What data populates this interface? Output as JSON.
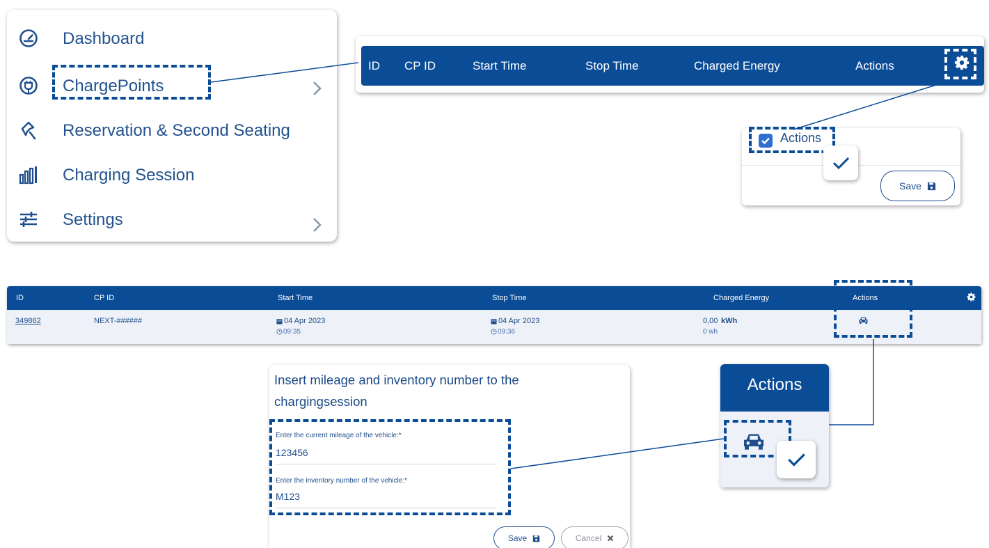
{
  "sidebar": {
    "items": [
      {
        "label": "Dashboard",
        "icon": "speedometer-icon"
      },
      {
        "label": "ChargePoints",
        "icon": "plug-icon"
      },
      {
        "label": "Reservation & Second Seating",
        "icon": "pin-icon"
      },
      {
        "label": "Charging Session",
        "icon": "bar-chart-icon"
      },
      {
        "label": "Settings",
        "icon": "sliders-icon"
      }
    ]
  },
  "header_strip": {
    "columns": [
      "ID",
      "CP ID",
      "Start Time",
      "Stop Time",
      "Charged Energy",
      "Actions"
    ],
    "settings_icon": "gear-icon"
  },
  "column_chooser": {
    "option_label": "Actions",
    "save_label": "Save",
    "save_icon": "floppy-disk-icon"
  },
  "table": {
    "headers": [
      "ID",
      "CP ID",
      "Start Time",
      "Stop Time",
      "Charged Energy",
      "Actions"
    ],
    "rows": [
      {
        "id": "349862",
        "cp_id": "NEXT-######",
        "start_date": "04 Apr 2023",
        "start_time": "09:35",
        "stop_date": "04 Apr 2023",
        "stop_time": "09:36",
        "energy_value": "0,00",
        "energy_unit": "kWh",
        "energy_sub": "0 wh",
        "action_icon": "car-icon"
      }
    ]
  },
  "dialog": {
    "title": "Insert mileage and inventory number to the chargingsession",
    "mileage_label": "Enter the current mileage of the vehicle:*",
    "mileage_value": "123456",
    "inventory_label": "Enter the inventory number of the vehicle:*",
    "inventory_value": "M123",
    "save_label": "Save",
    "cancel_label": "Cancel"
  },
  "actions_callout": {
    "title": "Actions",
    "icon": "car-icon"
  },
  "colors": {
    "primary": "#0b4c97",
    "text": "#1f4e8c",
    "row_bg": "#eef1f7"
  }
}
